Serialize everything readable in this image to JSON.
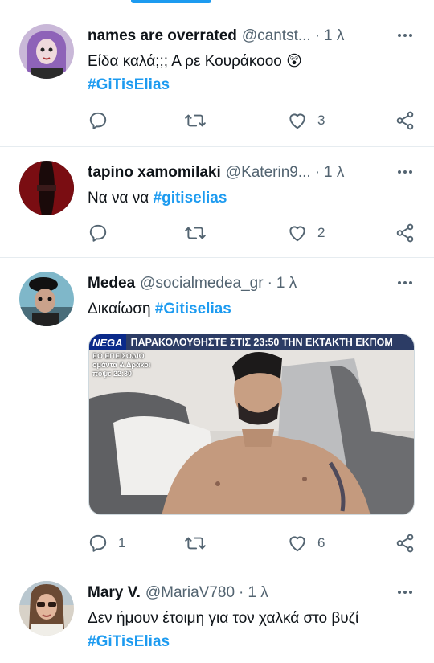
{
  "tweets": [
    {
      "name": "names are overrated",
      "handle": "@cantst...",
      "time": "1 λ",
      "text_plain": "Είδα καλά;;; Α ρε Κουράκοοο 😲",
      "hashtag": "#GiTisElias",
      "replies": "",
      "retweets": "",
      "likes": "3"
    },
    {
      "name": "tapino xamomilaki",
      "handle": "@Katerin9...",
      "time": "1 λ",
      "text_plain": "Να να να ",
      "hashtag": "#gitiselias",
      "replies": "",
      "retweets": "",
      "likes": "2"
    },
    {
      "name": "Medea",
      "handle": "@socialmedea_gr",
      "time": "1 λ",
      "text_plain": "Δικαίωση ",
      "hashtag": "#Gitiselias",
      "replies": "1",
      "retweets": "",
      "likes": "6",
      "media": {
        "logo": "NEGA",
        "banner": "ΠΑΡΑΚΟΛΟΥΘΗΣΤΕ ΣΤΙΣ 23:50 ΤΗΝ ΕΚΤΑΚΤΗ ΕΚΠΟΜ",
        "sub1": "ΕΟ ΕΠΕΙΣΟΔΙΟ",
        "sub2": "ομάντα & Δράκοι",
        "sub3": "πόψε 22:30"
      }
    },
    {
      "name": "Mary V.",
      "handle": "@MariaV780",
      "time": "1 λ",
      "text_plain": "Δεν ήμουν έτοιμη για τον χαλκά στο βυζί",
      "hashtag": "#GiTisElias"
    }
  ],
  "icons": {
    "reply": "reply-icon",
    "retweet": "retweet-icon",
    "like": "heart-icon",
    "share": "share-icon",
    "more": "more-icon"
  },
  "colors": {
    "accent": "#1d9bf0",
    "muted": "#536471",
    "text": "#0f1419"
  }
}
